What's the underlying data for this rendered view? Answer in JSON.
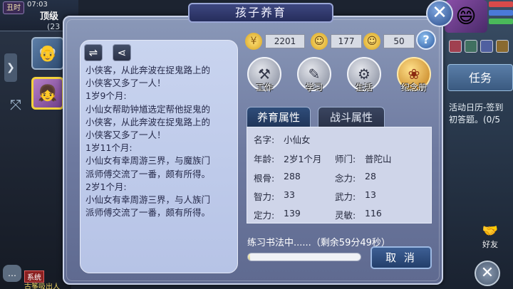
{
  "hud": {
    "time_badge": "丑时",
    "clock": "07:03",
    "map_name": "顶级",
    "coords": "(23",
    "task_button": "任务",
    "quest_text_1": "活动日历-签到",
    "quest_text_2": "初答题。(0/5",
    "friend_label": "好友",
    "system_tag": "系统",
    "chat_line": "古筝吸出人"
  },
  "dialog": {
    "title": "孩子养育",
    "currencies": [
      {
        "icon": "coin-icon",
        "value": "2201"
      },
      {
        "icon": "face-icon",
        "value": "177"
      },
      {
        "icon": "mood-icon",
        "value": "50"
      }
    ],
    "activities": [
      {
        "label": "工作"
      },
      {
        "label": "学习"
      },
      {
        "label": "生活"
      },
      {
        "label": "纪念册"
      }
    ],
    "tabs": [
      {
        "label": "养育属性",
        "active": true
      },
      {
        "label": "战斗属性",
        "active": false
      }
    ],
    "log_lines": [
      "小侠客，从此奔波在捉鬼路上的",
      "小侠客又多了一人！",
      "1岁9个月:",
      "小仙女帮助钟馗选定帮他捉鬼的",
      "小侠客，从此奔波在捉鬼路上的",
      "小侠客又多了一人！",
      "1岁11个月:",
      "小仙女有幸周游三界，与魔族门",
      "派师傅交流了一番，颇有所得。",
      "2岁1个月:",
      "小仙女有幸周游三界，与人族门",
      "派师傅交流了一番，颇有所得。"
    ],
    "attributes": {
      "name_label": "名字:",
      "name_value": "小仙女",
      "age_label": "年龄:",
      "age_value": "2岁1个月",
      "master_label": "师门:",
      "master_value": "普陀山",
      "root_label": "根骨:",
      "root_value": "288",
      "focus_label": "念力:",
      "focus_value": "28",
      "intellect_label": "智力:",
      "intellect_value": "33",
      "force_label": "武力:",
      "force_value": "13",
      "concentration_label": "定力:",
      "concentration_value": "139",
      "agility_label": "灵敏:",
      "agility_value": "116"
    },
    "progress_text": "练习书法中......（剩余59分49秒）",
    "progress_fraction": 0.02,
    "cancel_label": "取 消"
  }
}
